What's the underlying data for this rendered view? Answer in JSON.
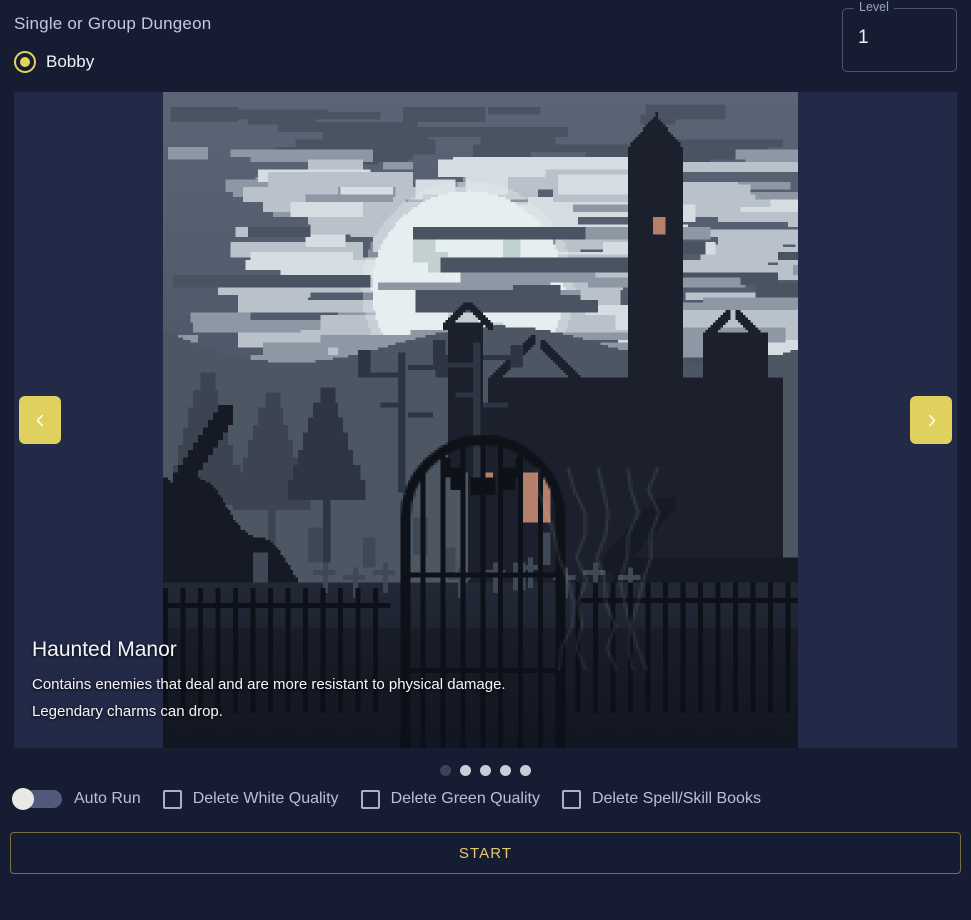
{
  "header": {
    "title": "Single or Group Dungeon",
    "character": {
      "name": "Bobby",
      "selected": true
    },
    "level_field": {
      "label": "Level",
      "value": "1"
    }
  },
  "carousel": {
    "prev_label": "‹",
    "next_label": "›",
    "slide": {
      "title": "Haunted Manor",
      "line1": "Contains enemies that deal and are more resistant to physical damage.",
      "line2": "Legendary charms can drop."
    },
    "dots": {
      "count": 5,
      "active_index": 0
    }
  },
  "options": {
    "auto_run": {
      "label": "Auto Run",
      "checked": false
    },
    "checkboxes": [
      {
        "label": "Delete White Quality",
        "checked": false
      },
      {
        "label": "Delete Green Quality",
        "checked": false
      },
      {
        "label": "Delete Spell/Skill Books",
        "checked": false
      }
    ]
  },
  "actions": {
    "start_label": "START"
  },
  "colors": {
    "page_bg": "#161d33",
    "panel_bg": "#232a47",
    "accent_gold": "#e0d05e",
    "start_text": "#e4c968",
    "text_primary": "#eef1f8",
    "text_muted": "#b9bfd4"
  }
}
